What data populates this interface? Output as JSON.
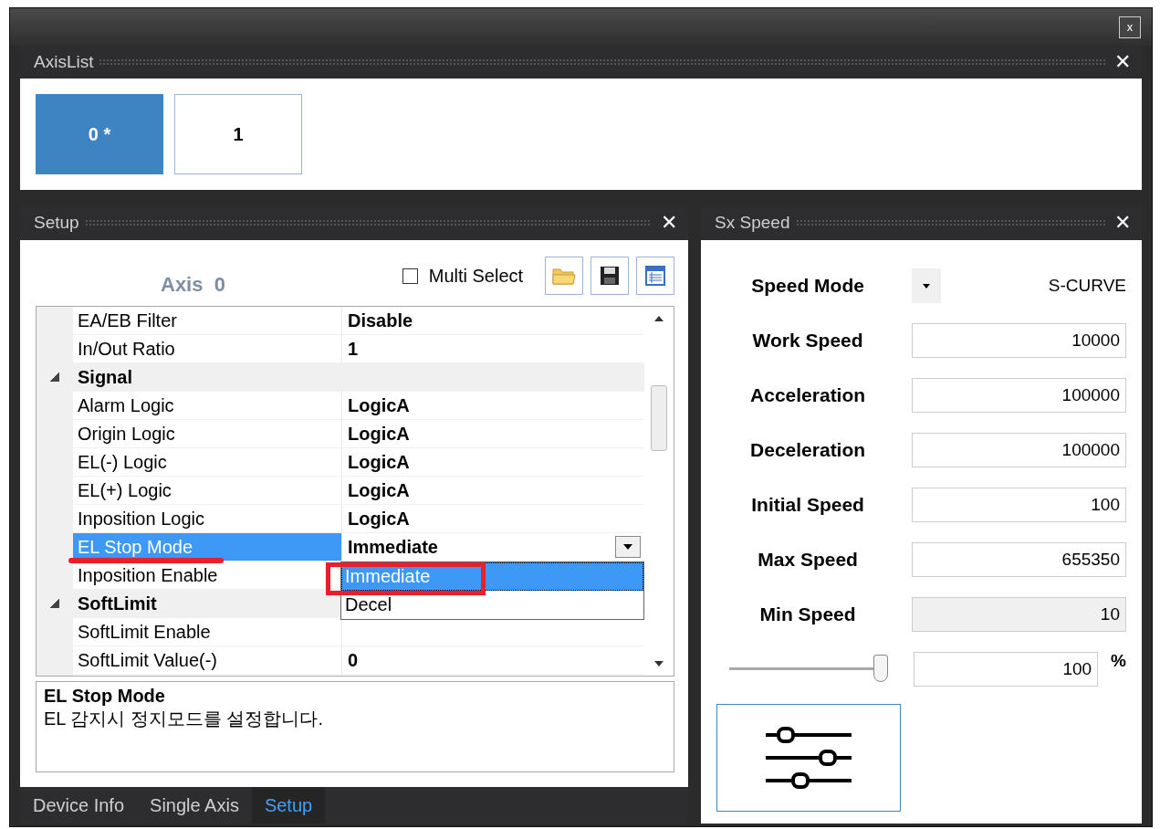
{
  "window": {
    "close": "x"
  },
  "axis_list": {
    "title": "AxisList",
    "close": "✕",
    "axes": [
      {
        "label": "0 *",
        "selected": true
      },
      {
        "label": "1",
        "selected": false
      }
    ]
  },
  "setup": {
    "title": "Setup",
    "close": "✕",
    "axis_label": "Axis  0",
    "multi_select": {
      "label": "Multi Select",
      "checked": false
    },
    "properties": [
      {
        "kind": "property",
        "name": "EA/EB Filter",
        "value": "Disable",
        "selected": false
      },
      {
        "kind": "property",
        "name": "In/Out Ratio",
        "value": "1",
        "selected": false
      },
      {
        "kind": "category",
        "name": "Signal",
        "expanded": true,
        "children": [
          {
            "kind": "property",
            "name": "Alarm Logic",
            "value": "LogicA",
            "selected": false
          },
          {
            "kind": "property",
            "name": "Origin Logic",
            "value": "LogicA",
            "selected": false
          },
          {
            "kind": "property",
            "name": "EL(-) Logic",
            "value": "LogicA",
            "selected": false
          },
          {
            "kind": "property",
            "name": "EL(+) Logic",
            "value": "LogicA",
            "selected": false
          },
          {
            "kind": "property",
            "name": "Inposition Logic",
            "value": "LogicA",
            "selected": false
          },
          {
            "kind": "property",
            "name": "EL Stop Mode",
            "value": "Immediate",
            "selected": true,
            "dropdown": [
              {
                "label": "Immediate",
                "selected": true
              },
              {
                "label": "Decel",
                "selected": false
              }
            ]
          },
          {
            "kind": "property",
            "name": "Inposition Enable",
            "selected": false
          }
        ]
      },
      {
        "kind": "category",
        "name": "SoftLimit",
        "expanded": true,
        "children": [
          {
            "kind": "property",
            "name": "SoftLimit Enable",
            "selected": false
          },
          {
            "kind": "property",
            "name": "SoftLimit Value(-)",
            "value": "0",
            "selected": false
          }
        ]
      }
    ],
    "description": {
      "title": "EL Stop Mode",
      "text": "EL 감지시 정지모드를 설정합니다."
    },
    "tabs": [
      {
        "label": "Device Info",
        "selected": false
      },
      {
        "label": "Single Axis",
        "selected": false
      },
      {
        "label": "Setup",
        "selected": true
      }
    ]
  },
  "speed": {
    "title": "Sx Speed",
    "close": "✕",
    "mode": {
      "label": "Speed Mode",
      "value": "S-CURVE"
    },
    "fields": [
      {
        "label": "Work Speed",
        "value": "10000",
        "disabled": false
      },
      {
        "label": "Acceleration",
        "value": "100000",
        "disabled": false
      },
      {
        "label": "Deceleration",
        "value": "100000",
        "disabled": false
      },
      {
        "label": "Initial Speed",
        "value": "100",
        "disabled": false
      },
      {
        "label": "Max Speed",
        "value": "655350",
        "disabled": false
      },
      {
        "label": "Min Speed",
        "value": "10",
        "disabled": true
      }
    ],
    "ratio": {
      "level": 1.0,
      "value": "100",
      "unit": "%"
    }
  }
}
